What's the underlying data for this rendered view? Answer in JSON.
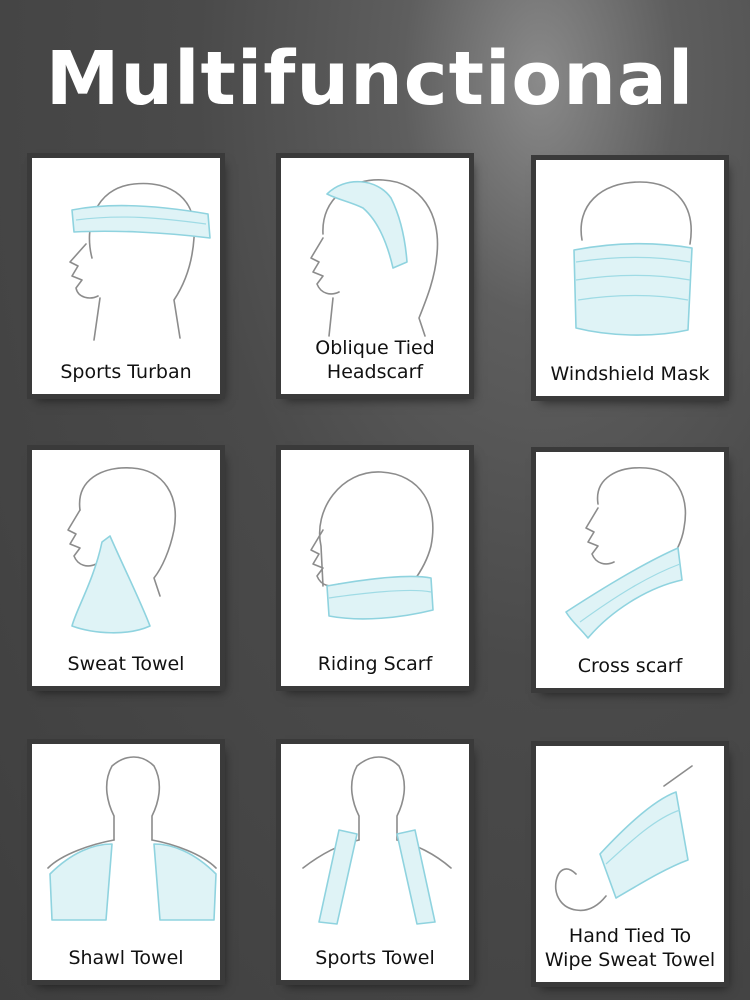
{
  "title": "Multifunctional",
  "colors": {
    "background": "#4a4a4a",
    "card": "#ffffff",
    "fabric": "#dff3f6",
    "fabric_stroke": "#8fd3df",
    "outline": "#8c8c8c"
  },
  "cards": [
    {
      "label": "Sports Turban",
      "icon": "sports-turban-illustration"
    },
    {
      "label": "Oblique Tied\nHeadscarf",
      "icon": "oblique-headscarf-illustration"
    },
    {
      "label": "Windshield Mask",
      "icon": "windshield-mask-illustration"
    },
    {
      "label": "Sweat Towel",
      "icon": "sweat-towel-illustration"
    },
    {
      "label": "Riding Scarf",
      "icon": "riding-scarf-illustration"
    },
    {
      "label": "Cross scarf",
      "icon": "cross-scarf-illustration"
    },
    {
      "label": "Shawl Towel",
      "icon": "shawl-towel-illustration"
    },
    {
      "label": "Sports Towel",
      "icon": "sports-towel-illustration"
    },
    {
      "label": "Hand Tied To\nWipe Sweat Towel",
      "icon": "hand-tied-towel-illustration"
    }
  ]
}
